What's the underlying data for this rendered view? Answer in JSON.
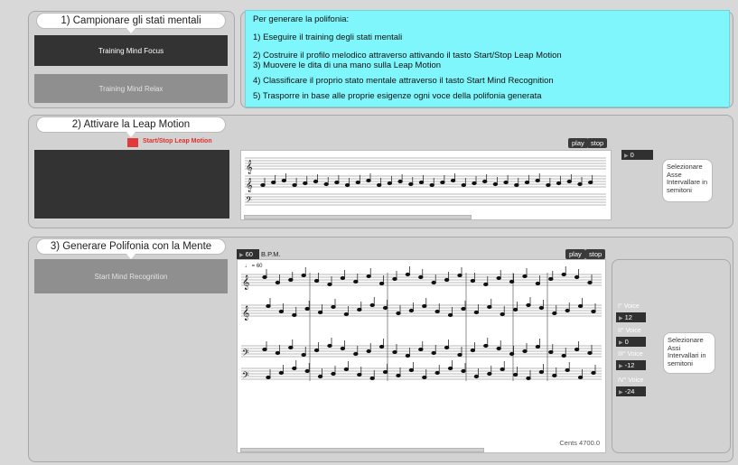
{
  "section1": {
    "title": "1) Campionare gli stati mentali",
    "focus_button": "Training Mind Focus",
    "relax_button": "Training Mind Relax"
  },
  "instructions": {
    "heading": "Per generare la polifonia:",
    "step1": "1) Eseguire il training degli stati mentali",
    "step2": "2)  Costruire il profilo melodico attraverso attivando il tasto Start/Stop Leap Motion",
    "step3": "3) Muovere le dita di una mano sulla Leap Motion",
    "step4": "4) Classificare il proprio stato mentale attraverso il tasto Start Mind Recognition",
    "step5": "5) Trasporre in base alle proprie esigenze ogni voce della polifonia generata"
  },
  "section2": {
    "title": "2) Attivare la Leap Motion",
    "toggle_label": "Start/Stop Leap Motion",
    "play": "play",
    "stop": "stop",
    "interval_value": "0",
    "callout": "Selezionare Asse Intervallare in semitoni"
  },
  "section3": {
    "title": "3) Generare Polifonia con la Mente",
    "recognition_button": "Start Mind Recognition",
    "bpm_value": "60",
    "bpm_label": "B.P.M.",
    "play": "play",
    "stop": "stop",
    "tempo_mark": "♩ = 60",
    "cents": "Cents 4700.0",
    "callout": "Selezionare Assi Intervallari in semitoni",
    "voices": [
      {
        "label": "I° Voice",
        "value": "12"
      },
      {
        "label": "II° Voice",
        "value": "0"
      },
      {
        "label": "III° Voice",
        "value": "-12"
      },
      {
        "label": "IV° Voice",
        "value": "-24"
      }
    ]
  },
  "colors": {
    "info_bg": "#7ff6fb",
    "toggle_red": "#e23a3a",
    "toggle_text": "#e03030"
  }
}
